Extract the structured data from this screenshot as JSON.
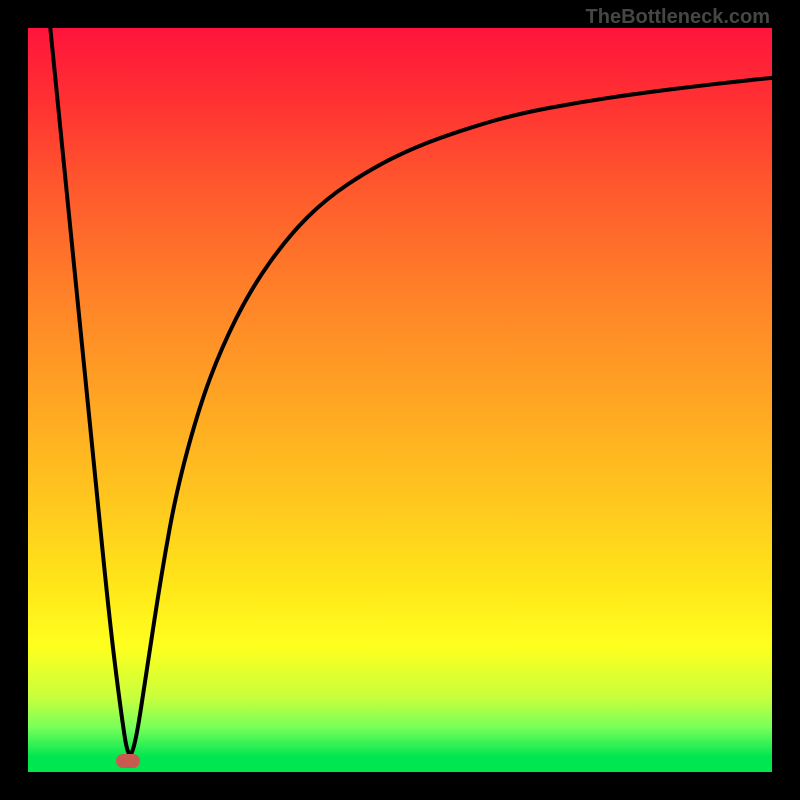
{
  "watermark": "TheBottleneck.com",
  "chart_data": {
    "type": "line",
    "title": "",
    "xlabel": "",
    "ylabel": "",
    "xlim": [
      0,
      100
    ],
    "ylim": [
      0,
      100
    ],
    "grid": false,
    "series": [
      {
        "name": "bottleneck-curve",
        "x": [
          3,
          5,
          7,
          9,
          11,
          12.5,
          13.5,
          14.5,
          16,
          18,
          20,
          23,
          26,
          30,
          35,
          40,
          46,
          52,
          59,
          66,
          74,
          82,
          90,
          97,
          100
        ],
        "y": [
          100,
          80,
          60,
          40,
          20,
          8,
          1.5,
          4,
          14,
          27,
          38,
          49,
          57,
          65,
          72,
          77,
          81,
          84,
          86.5,
          88.5,
          90,
          91.2,
          92.2,
          93,
          93.3
        ]
      }
    ],
    "min_point": {
      "x": 13.5,
      "y": 1.5
    },
    "marker_color": "#c85a50",
    "gradient_colors": [
      "#ff143c",
      "#ffa523",
      "#ffff1e",
      "#00e650"
    ]
  }
}
